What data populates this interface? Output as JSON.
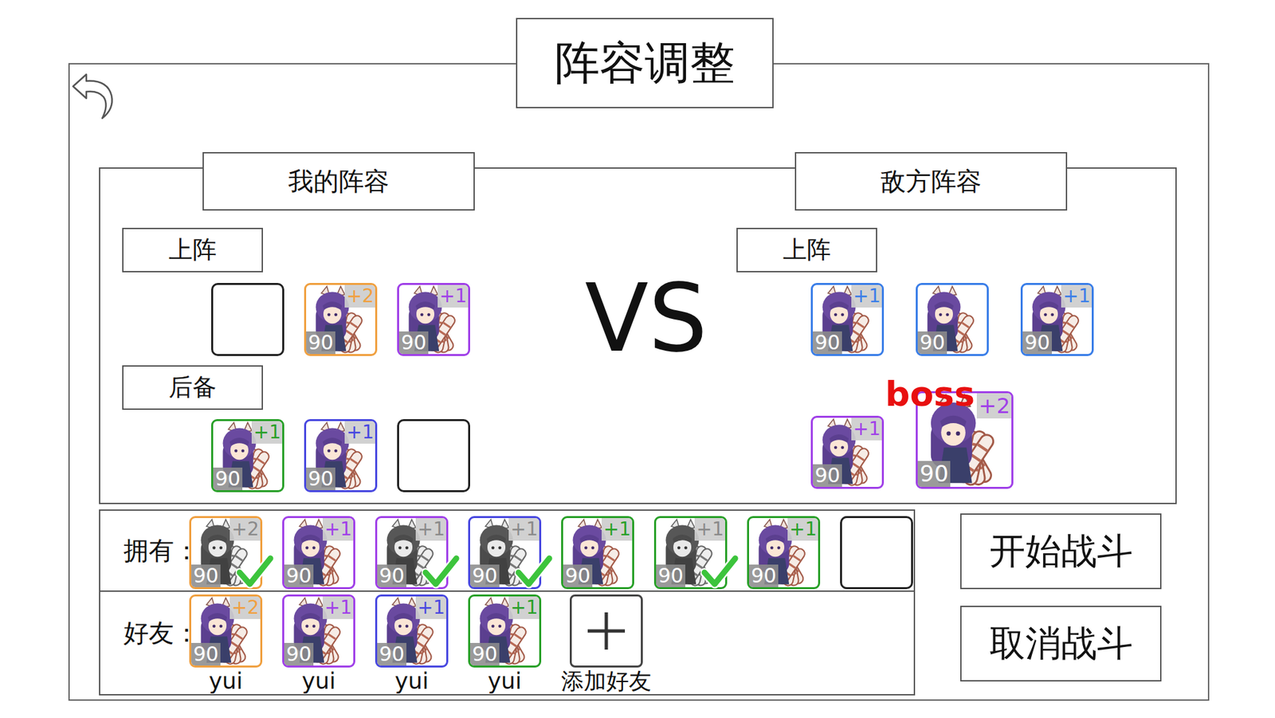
{
  "title": "阵容调整",
  "my_side": {
    "title": "我的阵容",
    "active_label": "上阵",
    "reserve_label": "后备",
    "active": [
      {
        "kind": "empty"
      },
      {
        "kind": "card",
        "level": "90",
        "plus": "+2",
        "color": "#f0a040"
      },
      {
        "kind": "card",
        "level": "90",
        "plus": "+1",
        "color": "#a040e8"
      }
    ],
    "reserve": [
      {
        "kind": "card",
        "level": "90",
        "plus": "+1",
        "color": "#28a028"
      },
      {
        "kind": "card",
        "level": "90",
        "plus": "+1",
        "color": "#4848e0"
      },
      {
        "kind": "empty"
      }
    ]
  },
  "vs": "VS",
  "enemy_side": {
    "title": "敌方阵容",
    "active_label": "上阵",
    "active": [
      {
        "kind": "card",
        "level": "90",
        "plus": "+1",
        "color": "#3a7ee8"
      },
      {
        "kind": "card",
        "level": "90",
        "color": "#3a7ee8"
      },
      {
        "kind": "card",
        "level": "90",
        "plus": "+1",
        "color": "#3a7ee8"
      }
    ],
    "reserve": [
      {
        "kind": "card",
        "level": "90",
        "plus": "+1",
        "color": "#a040e8"
      },
      {
        "kind": "boss",
        "tag": "boss",
        "level": "90",
        "plus": "+2",
        "color": "#a040e8"
      }
    ]
  },
  "owned": {
    "label": "拥有：",
    "items": [
      {
        "kind": "card",
        "level": "90",
        "plus": "+2",
        "color": "#f0a040",
        "checked": true
      },
      {
        "kind": "card",
        "level": "90",
        "plus": "+1",
        "color": "#a040e8",
        "checked": false
      },
      {
        "kind": "card",
        "level": "90",
        "plus": "+1",
        "color": "#a040e8",
        "checked": true
      },
      {
        "kind": "card",
        "level": "90",
        "plus": "+1",
        "color": "#4848e0",
        "checked": true
      },
      {
        "kind": "card",
        "level": "90",
        "plus": "+1",
        "color": "#28a028",
        "checked": false
      },
      {
        "kind": "card",
        "level": "90",
        "plus": "+1",
        "color": "#28a028",
        "checked": true
      },
      {
        "kind": "card",
        "level": "90",
        "plus": "+1",
        "color": "#28a028",
        "checked": false
      },
      {
        "kind": "empty",
        "checked": false
      }
    ]
  },
  "friends": {
    "label": "好友：",
    "items": [
      {
        "kind": "card",
        "name": "yui",
        "level": "90",
        "plus": "+2",
        "color": "#f0a040"
      },
      {
        "kind": "card",
        "name": "yui",
        "level": "90",
        "plus": "+1",
        "color": "#a040e8"
      },
      {
        "kind": "card",
        "name": "yui",
        "level": "90",
        "plus": "+1",
        "color": "#4848e0"
      },
      {
        "kind": "card",
        "name": "yui",
        "level": "90",
        "plus": "+1",
        "color": "#28a028"
      }
    ],
    "add": {
      "label": "添加好友"
    }
  },
  "buttons": [
    {
      "label": "开始战斗"
    },
    {
      "label": "取消战斗"
    }
  ]
}
